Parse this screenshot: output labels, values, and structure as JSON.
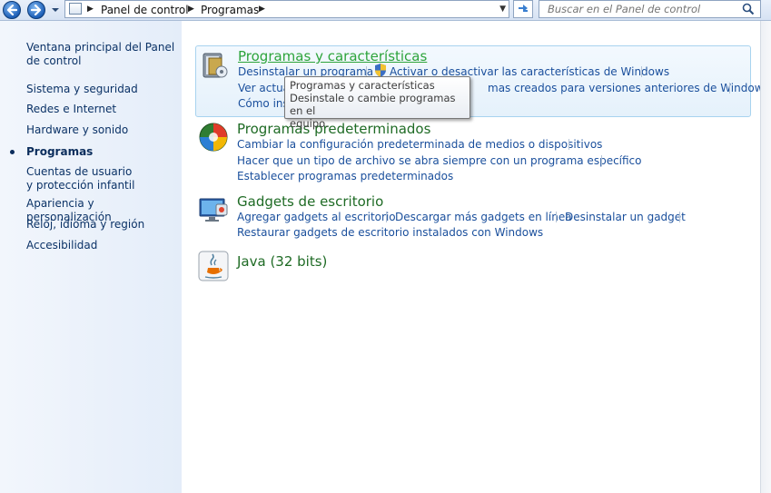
{
  "address": {
    "crumbs": [
      "Panel de control",
      "Programas"
    ],
    "search_placeholder": "Buscar en el Panel de control"
  },
  "sidebar": {
    "items": [
      {
        "label": "Ventana principal del Panel de control"
      },
      {
        "label": "Sistema y seguridad"
      },
      {
        "label": "Redes e Internet"
      },
      {
        "label": "Hardware y sonido"
      },
      {
        "label": "Programas",
        "current": true
      },
      {
        "label": "Cuentas de usuario y protección infantil"
      },
      {
        "label": "Apariencia y personalización"
      },
      {
        "label": "Reloj, idioma y región"
      },
      {
        "label": "Accesibilidad"
      }
    ]
  },
  "categories": [
    {
      "title": "Programas y características",
      "icon": "programs-features-icon",
      "links": [
        "Desinstalar un programa",
        "Activar o desactivar las características de Windows",
        "Ver actual",
        "mas creados para versiones anteriores de Windows",
        "Cómo ins"
      ]
    },
    {
      "title": "Programas predeterminados",
      "icon": "default-programs-icon",
      "links": [
        "Cambiar la configuración predeterminada de medios o dispositivos",
        "Hacer que un tipo de archivo se abra siempre con un programa específico",
        "Establecer programas predeterminados"
      ]
    },
    {
      "title": "Gadgets de escritorio",
      "icon": "desktop-gadgets-icon",
      "links": [
        "Agregar gadgets al escritorio",
        "Descargar más gadgets en línea",
        "Desinstalar un gadget",
        "Restaurar gadgets de escritorio instalados con Windows"
      ]
    },
    {
      "title": "Java (32 bits)",
      "icon": "java-icon",
      "links": []
    }
  ],
  "tooltip": {
    "line1": "Programas y características",
    "line2": "Desinstale o cambie programas en el",
    "line3": "equipo."
  }
}
